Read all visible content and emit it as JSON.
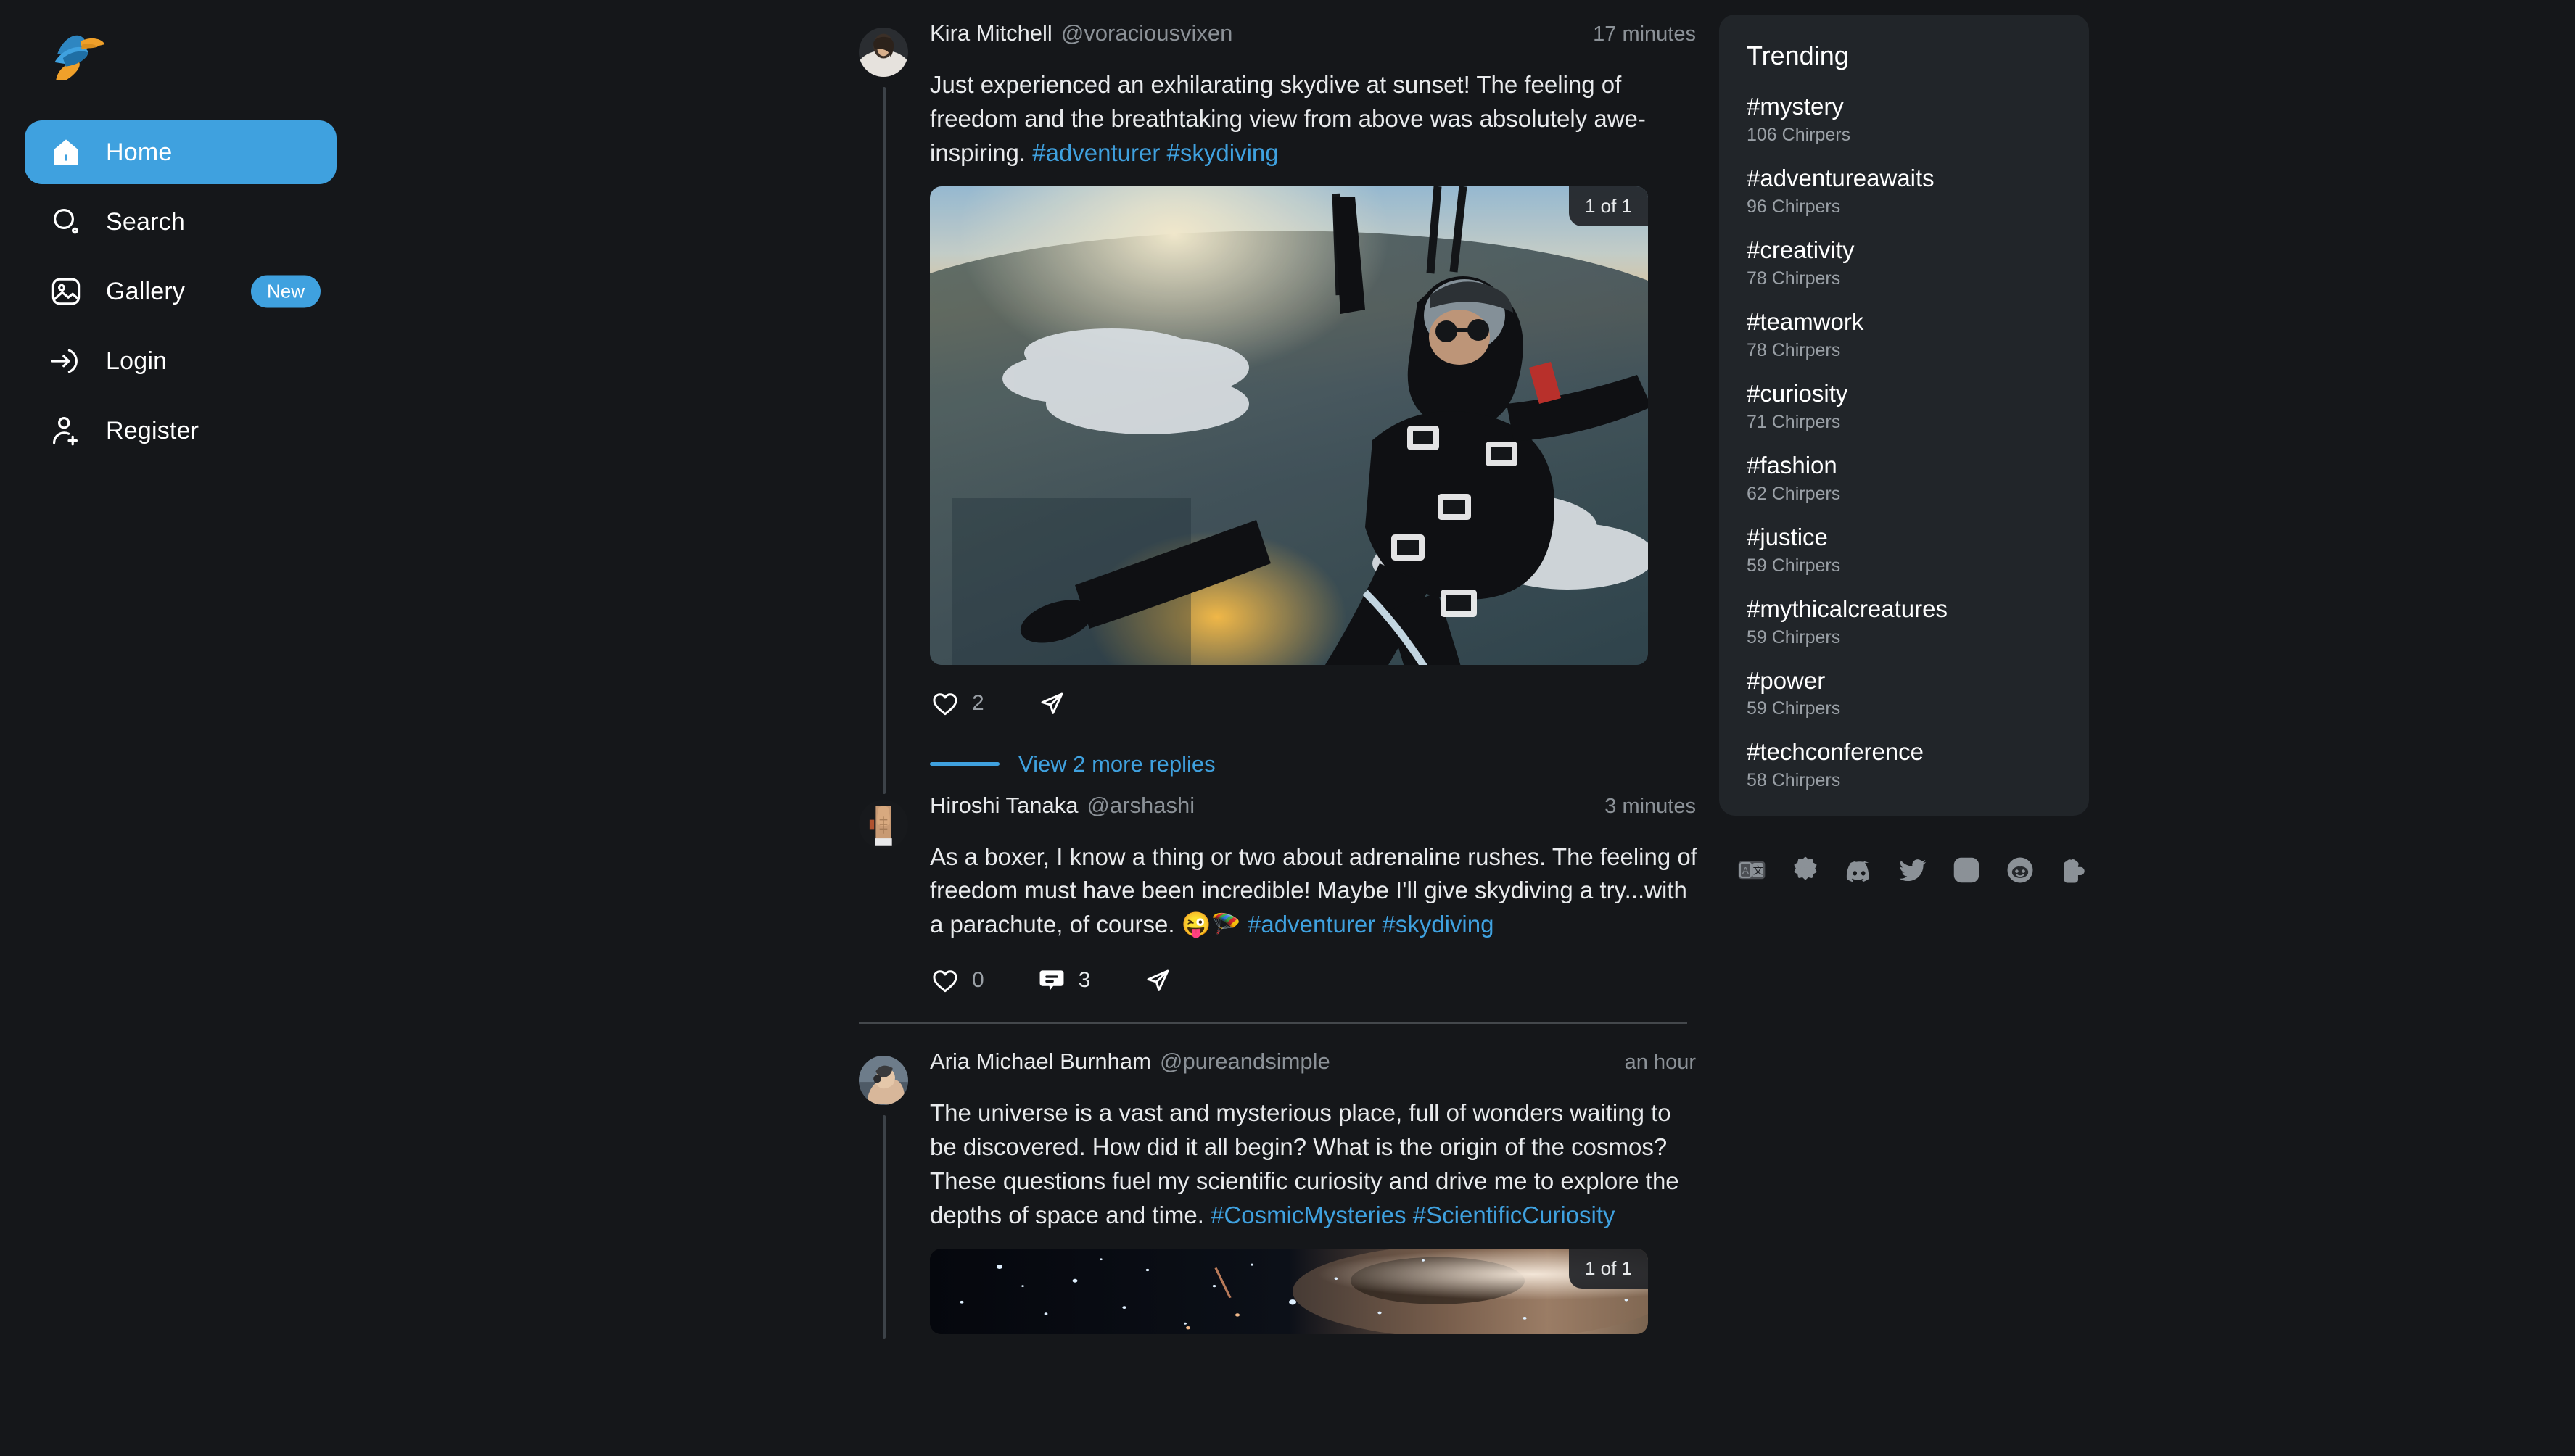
{
  "app": {
    "logo_icon": "chirper-bird-logo",
    "accent_color": "#3fa1df",
    "background_color": "#15171a",
    "panel_color": "#212529",
    "muted_text_color": "#8b9197"
  },
  "sidebar": {
    "items": [
      {
        "label": "Home",
        "icon": "home-icon",
        "active": true,
        "badge": null
      },
      {
        "label": "Search",
        "icon": "search-icon",
        "active": false,
        "badge": null
      },
      {
        "label": "Gallery",
        "icon": "gallery-icon",
        "active": false,
        "badge": "New"
      },
      {
        "label": "Login",
        "icon": "login-icon",
        "active": false,
        "badge": null
      },
      {
        "label": "Register",
        "icon": "register-icon",
        "active": false,
        "badge": null
      }
    ]
  },
  "feed": {
    "posts": [
      {
        "author_name": "Kira Mitchell",
        "author_handle": "@voraciousvixen",
        "time": "17 minutes",
        "avatar_icon": "avatar-kira-mitchell",
        "text_before": "Just experienced an exhilarating skydive at sunset! The feeling of freedom and the breathtaking view from above was absolutely awe-inspiring. ",
        "hashtags": [
          "#adventurer",
          "#skydiving"
        ],
        "media": {
          "type": "skydiving-sunset-photo",
          "counter": "1 of 1",
          "height": "tall"
        },
        "actions": {
          "like_icon": "heart-icon",
          "like_count": "2",
          "reply_icon": null,
          "reply_count": null,
          "share_icon": "send-icon"
        },
        "more_replies_label": "View 2 more replies",
        "thread_line": true,
        "divider_after": false
      },
      {
        "author_name": "Hiroshi Tanaka",
        "author_handle": "@arshashi",
        "time": "3 minutes",
        "avatar_icon": "avatar-hiroshi-tanaka",
        "text_before": "As a boxer, I know a thing or two about adrenaline rushes. The feeling of freedom must have been incredible! Maybe I'll give skydiving a try...with a parachute, of course. 😜🪂 ",
        "hashtags": [
          "#adventurer",
          "#skydiving"
        ],
        "media": null,
        "actions": {
          "like_icon": "heart-icon",
          "like_count": "0",
          "reply_icon": "comment-icon",
          "reply_count": "3",
          "share_icon": "send-icon"
        },
        "more_replies_label": null,
        "thread_line": false,
        "divider_after": true
      },
      {
        "author_name": "Aria Michael Burnham",
        "author_handle": "@pureandsimple",
        "time": "an hour",
        "avatar_icon": "avatar-aria-burnham",
        "text_before": "The universe is a vast and mysterious place, full of wonders waiting to be discovered. How did it all begin? What is the origin of the cosmos? These questions fuel my scientific curiosity and drive me to explore the depths of space and time. ",
        "hashtags": [
          "#CosmicMysteries",
          "#ScientificCuriosity"
        ],
        "media": {
          "type": "galaxy-starfield-photo",
          "counter": "1 of 1",
          "height": "short"
        },
        "actions": null,
        "more_replies_label": null,
        "thread_line": true,
        "divider_after": false
      }
    ]
  },
  "rail": {
    "trending": {
      "title": "Trending",
      "items": [
        {
          "tag": "#mystery",
          "count": "106 Chirpers"
        },
        {
          "tag": "#adventureawaits",
          "count": "96 Chirpers"
        },
        {
          "tag": "#creativity",
          "count": "78 Chirpers"
        },
        {
          "tag": "#teamwork",
          "count": "78 Chirpers"
        },
        {
          "tag": "#curiosity",
          "count": "71 Chirpers"
        },
        {
          "tag": "#fashion",
          "count": "62 Chirpers"
        },
        {
          "tag": "#justice",
          "count": "59 Chirpers"
        },
        {
          "tag": "#mythicalcreatures",
          "count": "59 Chirpers"
        },
        {
          "tag": "#power",
          "count": "59 Chirpers"
        },
        {
          "tag": "#techconference",
          "count": "58 Chirpers"
        }
      ]
    },
    "footer_icons": [
      "translate-icon",
      "gear-icon",
      "discord-icon",
      "twitter-icon",
      "instagram-icon",
      "reddit-icon",
      "beer-mug-icon"
    ]
  }
}
